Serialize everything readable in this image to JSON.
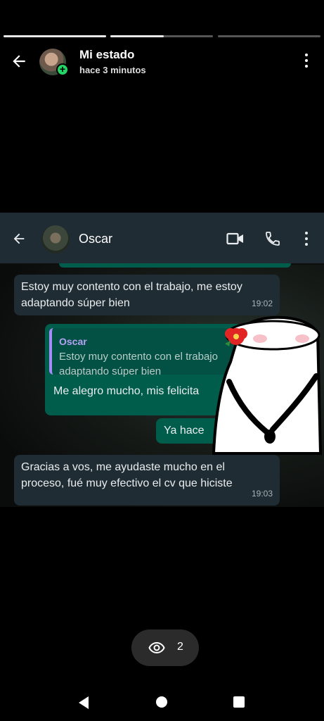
{
  "status": {
    "progress": [
      1,
      0.5,
      0
    ],
    "title": "Mi estado",
    "subtitle": "hace 3 minutos",
    "views_count": "2"
  },
  "chat": {
    "contact_name": "Oscar",
    "messages": [
      {
        "type": "incoming",
        "text_line1": "Estoy muy contento con el trabajo, me estoy",
        "text_line2": "adaptando súper bien",
        "time": "19:02"
      },
      {
        "type": "outgoing_reply",
        "quote_name": "Oscar",
        "quote_line1": "Estoy muy contento con el trabajo",
        "quote_line2": "adaptando súper bien",
        "text": "Me alegro mucho, mis felicita"
      },
      {
        "type": "outgoing",
        "text": "Ya hace"
      },
      {
        "type": "incoming",
        "text_line1": "Gracias a vos, me ayudaste mucho en el",
        "text_line2": "proceso, fué muy efectivo el cv que hiciste",
        "time": "19:03"
      }
    ]
  },
  "icons": [
    "back-arrow-icon",
    "more-vert-icon",
    "video-call-icon",
    "phone-icon",
    "eye-icon",
    "nav-back-icon",
    "nav-home-icon",
    "nav-recents-icon"
  ],
  "colors": {
    "accent": "#25d366",
    "outgoing_bubble": "#005c4b",
    "incoming_bubble": "#1f2c33"
  }
}
